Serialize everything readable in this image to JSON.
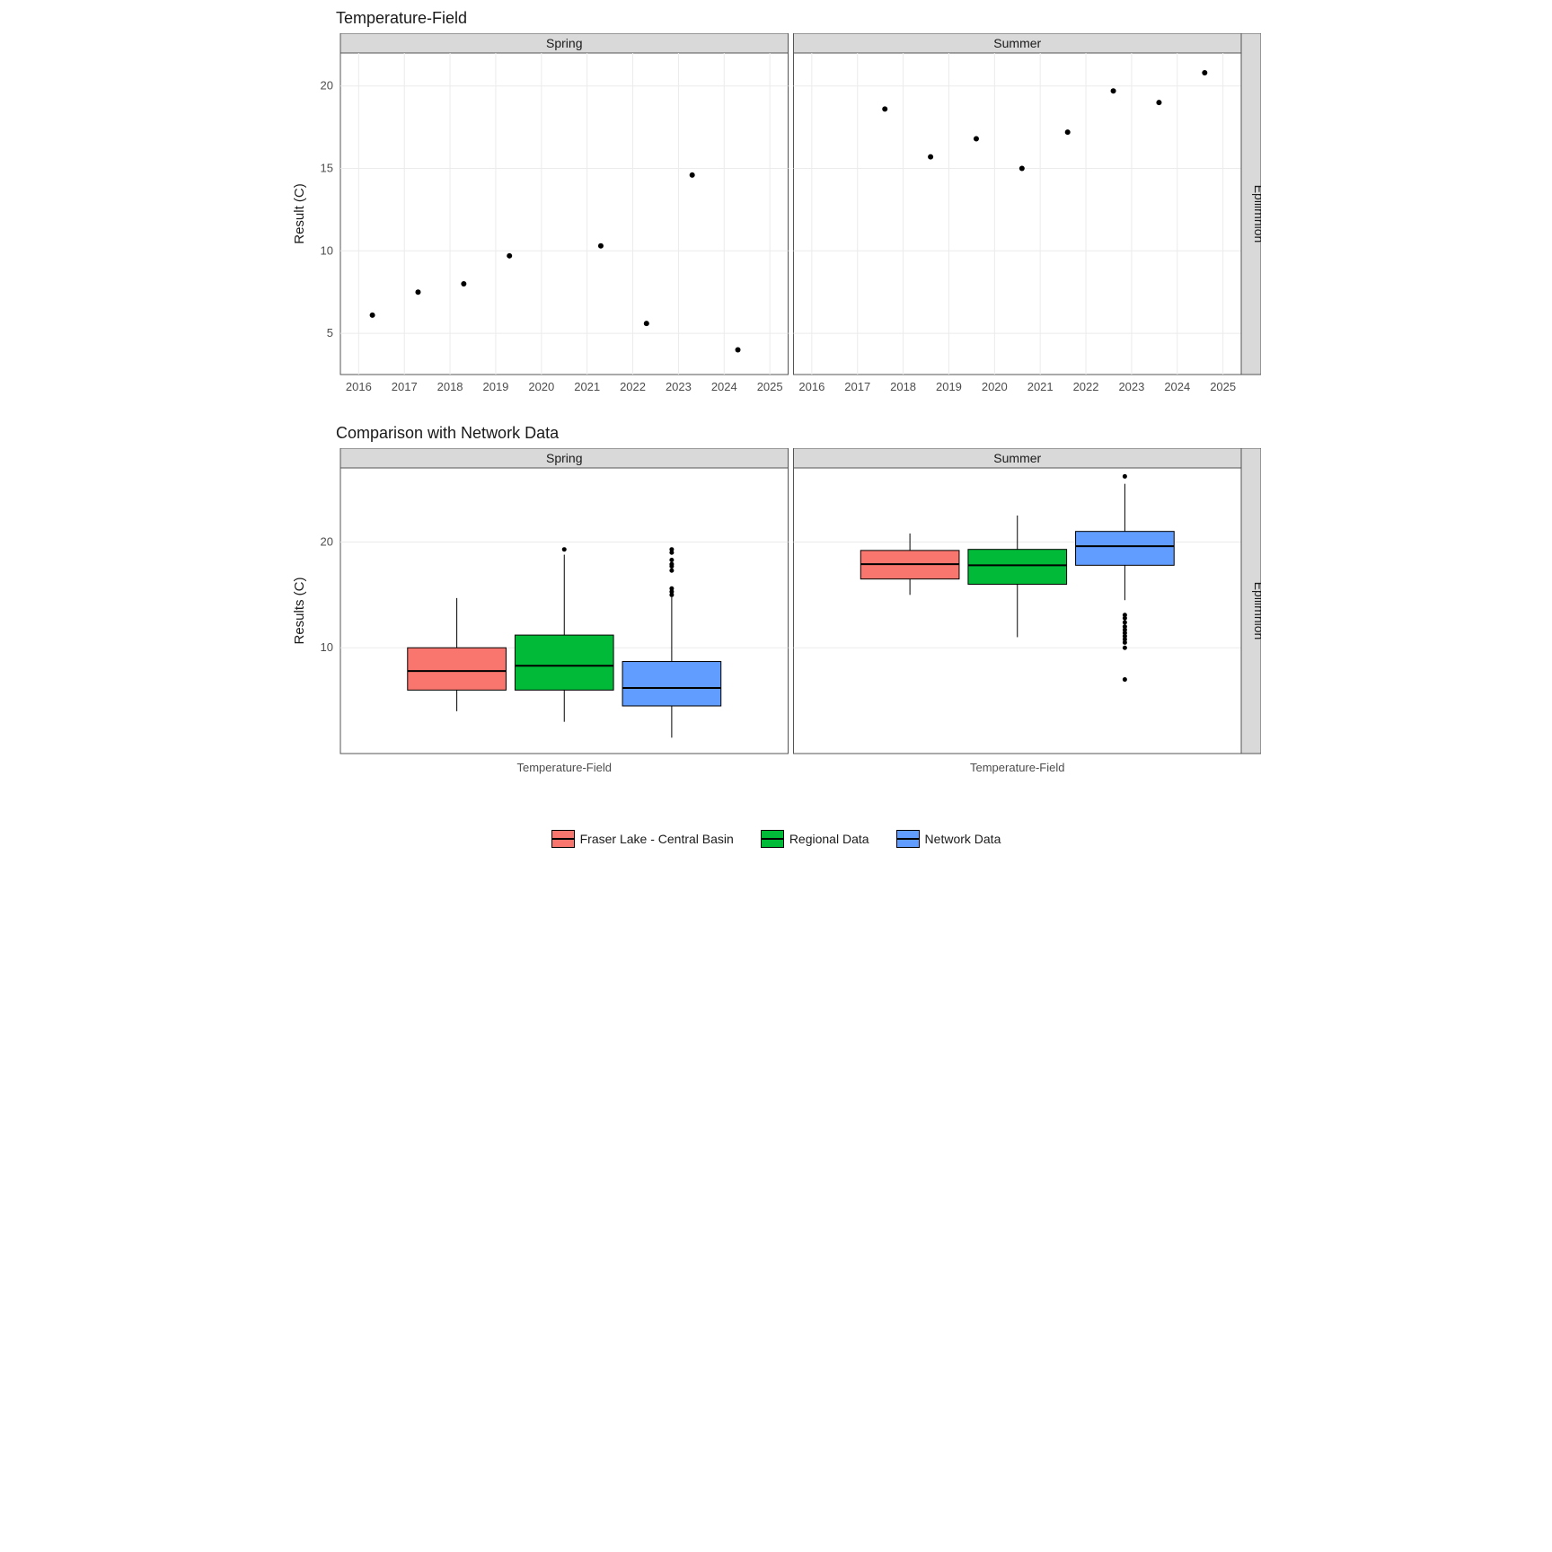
{
  "chart_data": [
    {
      "type": "scatter",
      "title": "Temperature-Field",
      "ylabel": "Result (C)",
      "xlabel": "",
      "facet_right": "Epilimnion",
      "facets_top": [
        "Spring",
        "Summer"
      ],
      "x_ticks": [
        2016,
        2017,
        2018,
        2019,
        2020,
        2021,
        2022,
        2023,
        2024,
        2025
      ],
      "y_ticks": [
        5,
        10,
        15,
        20
      ],
      "xlim": [
        2015.6,
        2025.4
      ],
      "ylim": [
        2.5,
        22
      ],
      "series": [
        {
          "name": "Spring",
          "points": [
            {
              "x": 2016.3,
              "y": 6.1
            },
            {
              "x": 2017.3,
              "y": 7.5
            },
            {
              "x": 2018.3,
              "y": 8.0
            },
            {
              "x": 2019.3,
              "y": 9.7
            },
            {
              "x": 2021.3,
              "y": 10.3
            },
            {
              "x": 2022.3,
              "y": 5.6
            },
            {
              "x": 2023.3,
              "y": 14.6
            },
            {
              "x": 2024.3,
              "y": 4.0
            }
          ]
        },
        {
          "name": "Summer",
          "points": [
            {
              "x": 2017.6,
              "y": 18.6
            },
            {
              "x": 2018.6,
              "y": 15.7
            },
            {
              "x": 2019.6,
              "y": 16.8
            },
            {
              "x": 2020.6,
              "y": 15.0
            },
            {
              "x": 2021.6,
              "y": 17.2
            },
            {
              "x": 2022.6,
              "y": 19.7
            },
            {
              "x": 2023.6,
              "y": 19.0
            },
            {
              "x": 2024.6,
              "y": 20.8
            }
          ]
        }
      ]
    },
    {
      "type": "box",
      "title": "Comparison with Network Data",
      "ylabel": "Results (C)",
      "xlabel": "Temperature-Field",
      "facet_right": "Epilimnion",
      "facets_top": [
        "Spring",
        "Summer"
      ],
      "y_ticks": [
        10,
        20
      ],
      "ylim": [
        0,
        27
      ],
      "groups": [
        "Fraser Lake - Central Basin",
        "Regional Data",
        "Network Data"
      ],
      "colors": {
        "Fraser Lake - Central Basin": "#F8766D",
        "Regional Data": "#00BA38",
        "Network Data": "#619CFF"
      },
      "summaries": {
        "Spring": [
          {
            "group": "Fraser Lake - Central Basin",
            "min": 4.0,
            "q1": 6.0,
            "med": 7.8,
            "q3": 10.0,
            "max": 14.7,
            "out": []
          },
          {
            "group": "Regional Data",
            "min": 3.0,
            "q1": 6.0,
            "med": 8.3,
            "q3": 11.2,
            "max": 18.8,
            "out": [
              19.3
            ]
          },
          {
            "group": "Network Data",
            "min": 1.5,
            "q1": 4.5,
            "med": 6.2,
            "q3": 8.7,
            "max": 14.8,
            "out": [
              15.0,
              15.3,
              15.6,
              17.3,
              17.7,
              17.9,
              18.3,
              19.0,
              19.3
            ]
          }
        ],
        "Summer": [
          {
            "group": "Fraser Lake - Central Basin",
            "min": 15.0,
            "q1": 16.5,
            "med": 17.9,
            "q3": 19.2,
            "max": 20.8,
            "out": []
          },
          {
            "group": "Regional Data",
            "min": 11.0,
            "q1": 16.0,
            "med": 17.8,
            "q3": 19.3,
            "max": 22.5,
            "out": []
          },
          {
            "group": "Network Data",
            "min": 14.5,
            "q1": 17.8,
            "med": 19.6,
            "q3": 21.0,
            "max": 25.5,
            "out": [
              7.0,
              10.0,
              10.5,
              10.8,
              11.1,
              11.4,
              11.7,
              12.0,
              12.4,
              12.8,
              13.1,
              26.2
            ]
          }
        ]
      }
    }
  ],
  "legend": {
    "items": [
      {
        "label": "Fraser Lake - Central Basin",
        "color": "#F8766D"
      },
      {
        "label": "Regional Data",
        "color": "#00BA38"
      },
      {
        "label": "Network Data",
        "color": "#619CFF"
      }
    ]
  }
}
